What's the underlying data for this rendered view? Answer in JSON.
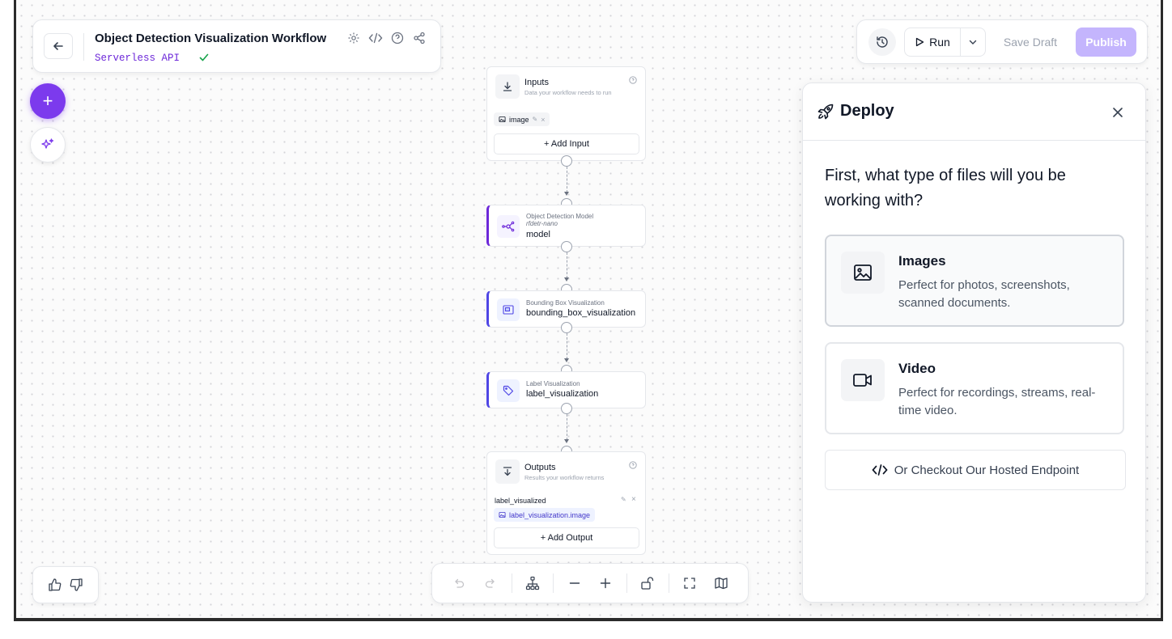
{
  "header": {
    "title": "Object Detection Visualization Workflow",
    "subtitle": "Serverless API"
  },
  "toolbar": {
    "run_label": "Run",
    "save_draft_label": "Save Draft",
    "publish_label": "Publish"
  },
  "nodes": {
    "inputs": {
      "title": "Inputs",
      "description": "Data your workflow needs to run",
      "items": [
        "image"
      ],
      "add_label": "+ Add Input"
    },
    "model": {
      "type": "Object Detection Model",
      "subtype": "rfdetr-nano",
      "name": "model"
    },
    "bbox": {
      "type": "Bounding Box Visualization",
      "name": "bounding_box_visualization"
    },
    "label": {
      "type": "Label Visualization",
      "name": "label_visualization"
    },
    "outputs": {
      "title": "Outputs",
      "description": "Results your workflow returns",
      "output_name": "label_visualized",
      "output_value": "label_visualization.image",
      "add_label": "+ Add Output"
    }
  },
  "deploy": {
    "title": "Deploy",
    "question": "First, what type of files will you be working with?",
    "options": [
      {
        "title": "Images",
        "description": "Perfect for photos, screenshots, scanned documents.",
        "icon": "image-icon"
      },
      {
        "title": "Video",
        "description": "Perfect for recordings, streams, real-time video.",
        "icon": "video-icon"
      }
    ],
    "hosted_label": "Or Checkout Our Hosted Endpoint"
  },
  "colors": {
    "accent": "#7c3aed",
    "publish_disabled": "#c4b5fd",
    "success": "#16a34a",
    "node_bar": "#4f46e5"
  }
}
